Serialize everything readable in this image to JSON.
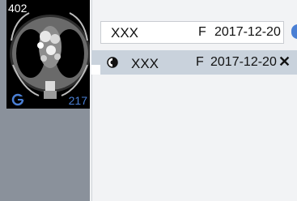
{
  "thumbnail": {
    "image_number": "402",
    "image_count": "217",
    "icon": "series-sync-icon"
  },
  "study_header": {
    "patient_name": "XXX",
    "sex": "F",
    "date": "2017-12-20"
  },
  "series_list": [
    {
      "icon": "contrast-icon",
      "patient_name": "XXX",
      "sex": "F",
      "date": "2017-12-20",
      "close_icon": "close-icon",
      "close_label": "✕"
    }
  ],
  "colors": {
    "accent": "#4a7fd4",
    "strip": "#8a919b",
    "selected_row": "#c9d2dc"
  }
}
